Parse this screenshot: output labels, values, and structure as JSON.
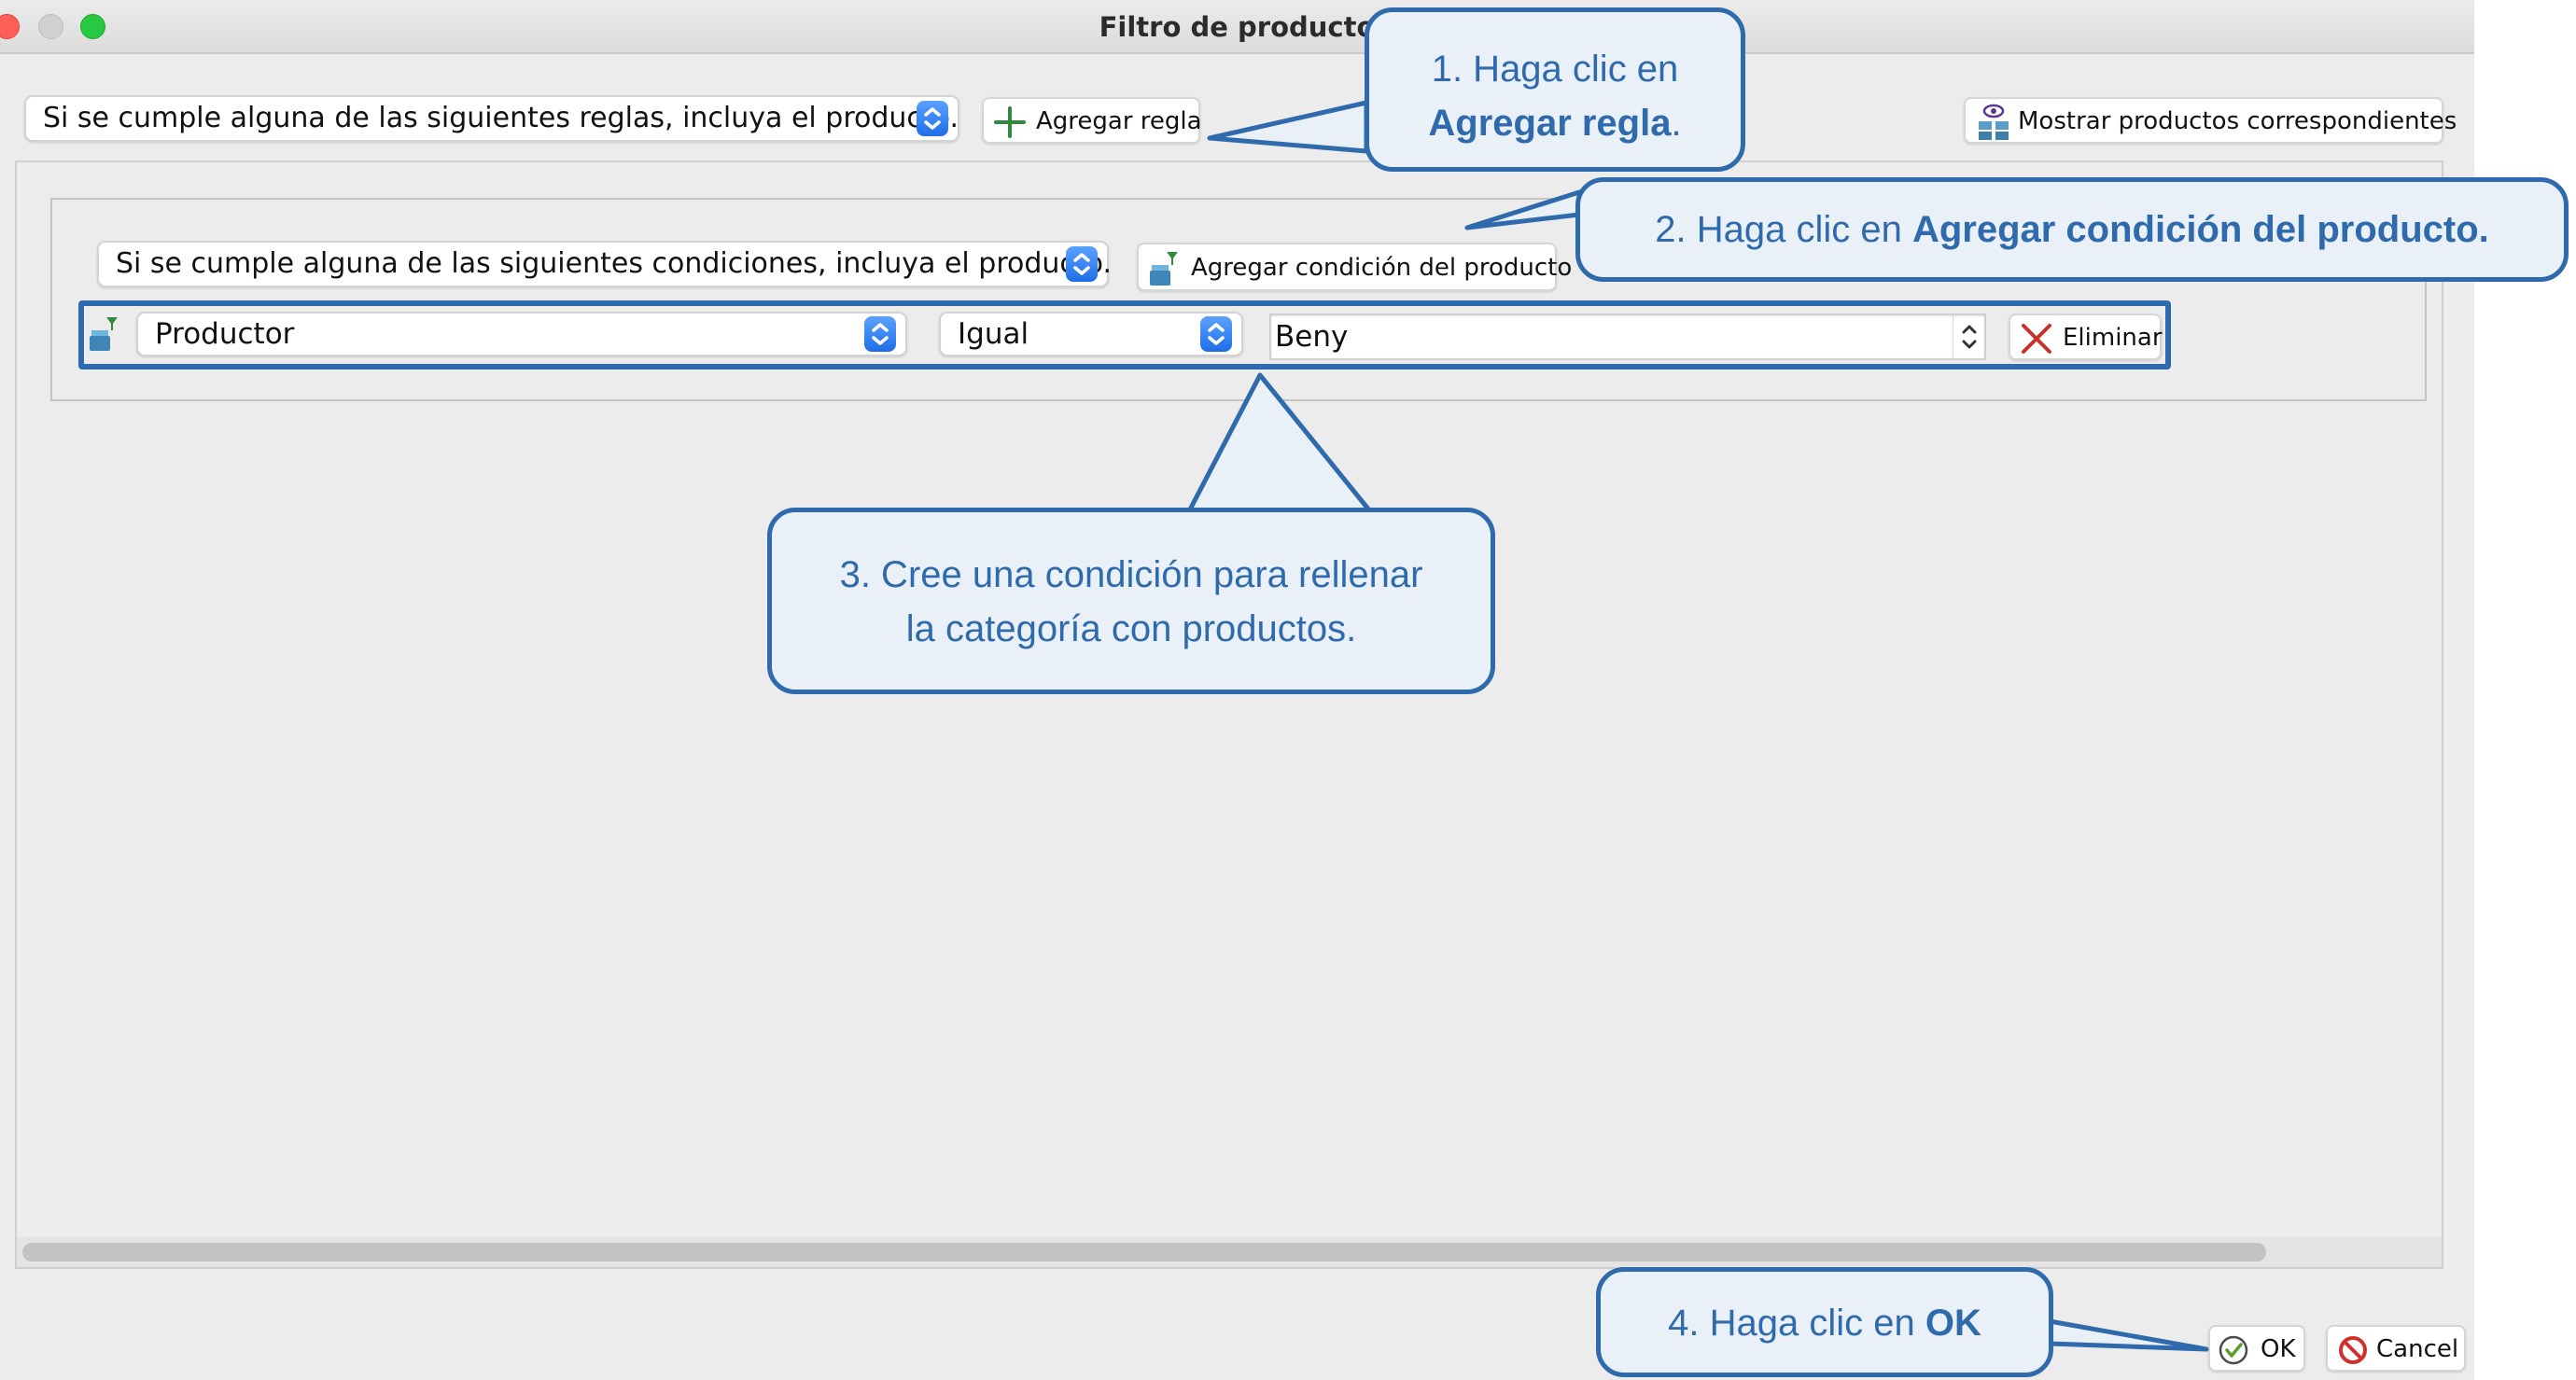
{
  "window": {
    "title": "Filtro de producto"
  },
  "rule_bar": {
    "match_select": "Si se cumple alguna de las siguientes reglas, incluya el producto.",
    "add_rule_label": "Agregar regla",
    "show_products_label": "Mostrar productos correspondientes"
  },
  "condition_group": {
    "match_select": "Si se cumple alguna de las siguientes condiciones, incluya el producto.",
    "add_condition_label": "Agregar condición del producto"
  },
  "condition_row": {
    "field": "Productor",
    "operator": "Igual",
    "value": "Beny",
    "delete_label": "Eliminar"
  },
  "footer": {
    "ok_label": "OK",
    "cancel_label": "Cancel"
  },
  "callouts": {
    "c1_prefix": "1. Haga clic en",
    "c1_bold": "Agregar regla",
    "c1_suffix": ".",
    "c2_prefix": "2. Haga clic en ",
    "c2_bold": "Agregar condición del producto.",
    "c3_line1": "3. Cree una condición para rellenar",
    "c3_line2": "la categoría con productos.",
    "c4_prefix": "4. Haga clic en ",
    "c4_bold": "OK"
  },
  "colors": {
    "callout_border": "#2f6aad",
    "callout_fill": "#eaf0f7",
    "stepper_blue": "#2a78f0",
    "close_red": "#ff5f57",
    "zoom_green": "#28c840",
    "minimize_gray": "#d0d0d0"
  }
}
